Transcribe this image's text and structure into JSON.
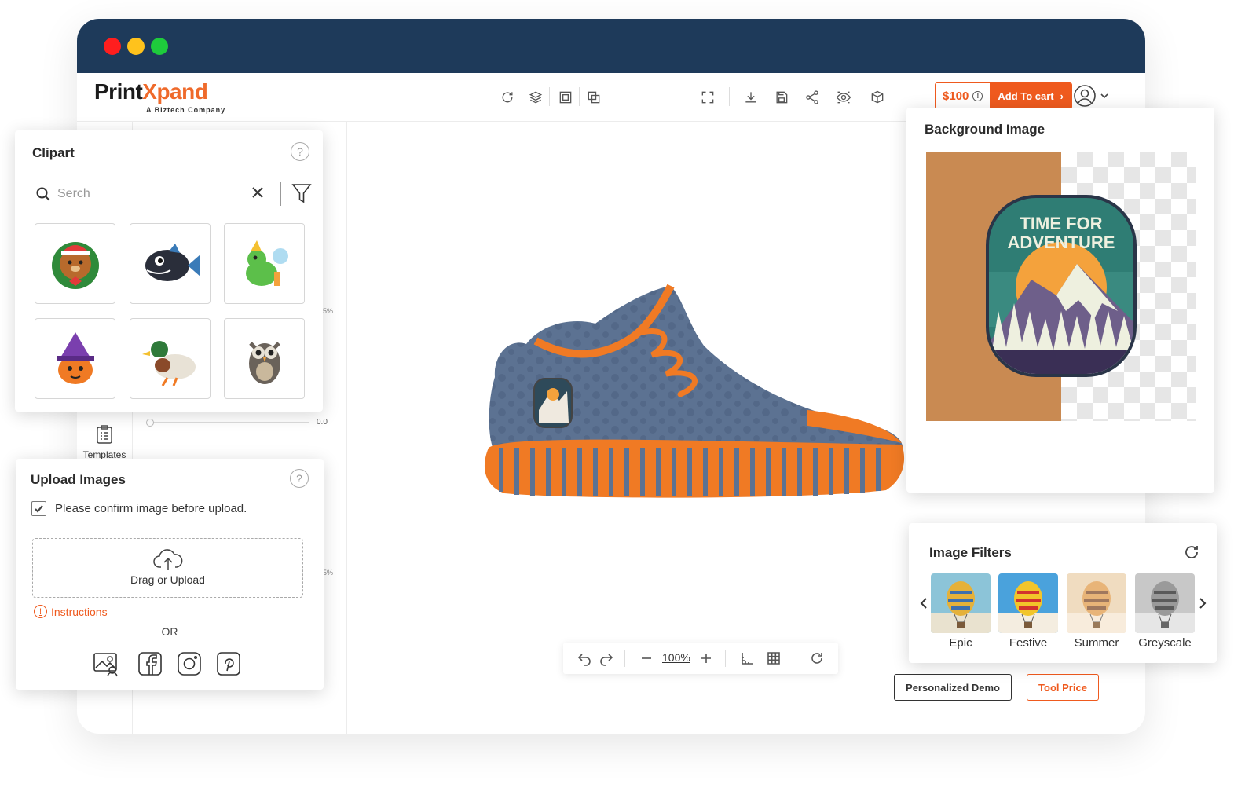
{
  "brand": {
    "name_part1": "Print",
    "name_part2": "Xpand",
    "tagline": "A Biztech Company"
  },
  "toolbar": {
    "icons": [
      "reset-icon",
      "layers-icon",
      "group-icon",
      "arrange-icon",
      "fullscreen-icon",
      "download-icon",
      "save-icon",
      "share-icon",
      "preview-icon",
      "3d-icon"
    ],
    "price": "$100",
    "add_to_cart": "Add To cart"
  },
  "sidebar": {
    "templates_label": "Templates",
    "slider_value": "0.0",
    "percent_a": "5%",
    "percent_b": "5%"
  },
  "clipart": {
    "title": "Clipart",
    "search_placeholder": "Serch",
    "items": [
      "teddy-bear",
      "piranha-fish",
      "dinosaur",
      "pumpkin-witch",
      "mallard-duck",
      "owl"
    ]
  },
  "upload": {
    "title": "Upload Images",
    "confirm_label": "Please confirm image before upload.",
    "confirm_checked": true,
    "drop_label": "Drag or Upload",
    "instructions_label": "Instructions",
    "or_label": "OR",
    "sources": [
      "gallery-icon",
      "facebook-icon",
      "instagram-icon",
      "pinterest-icon"
    ]
  },
  "canvas": {
    "zoom": "100%"
  },
  "actions": {
    "demo_label": "Personalized Demo",
    "tool_price_label": "Tool Price"
  },
  "background_image": {
    "title": "Background Image",
    "badge_line1": "TIME FOR",
    "badge_line2": "ADVENTURE",
    "left_color": "#c98a52"
  },
  "filters": {
    "title": "Image Filters",
    "items": [
      {
        "label": "Epic"
      },
      {
        "label": "Festive"
      },
      {
        "label": "Summer"
      },
      {
        "label": "Greyscale"
      }
    ]
  },
  "colors": {
    "accent": "#ef5a1e",
    "titlebar": "#1e3a5a"
  }
}
